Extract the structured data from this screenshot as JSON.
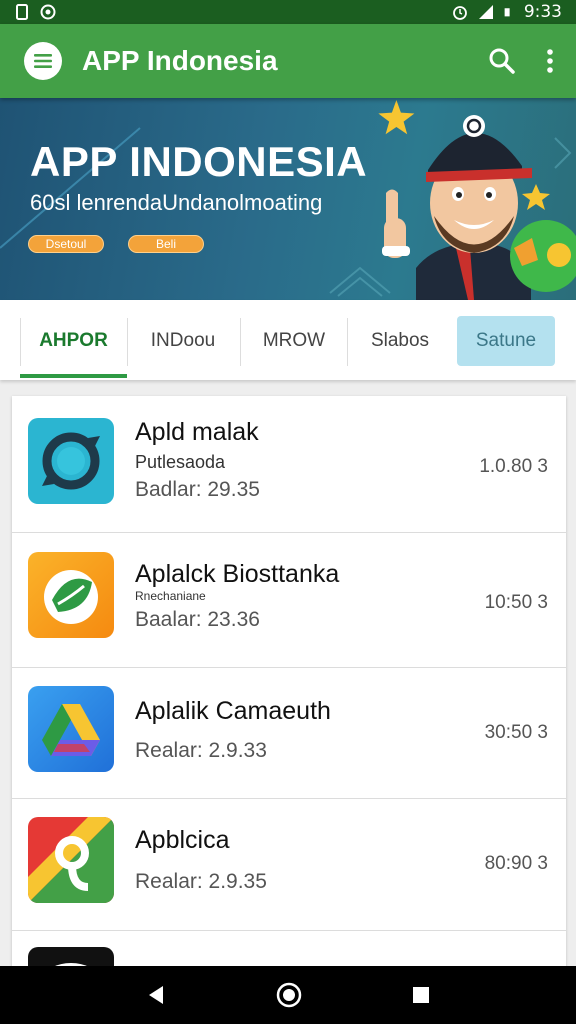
{
  "status_bar": {
    "time": "9:33"
  },
  "app_bar": {
    "title": "APP Indonesia"
  },
  "banner": {
    "title": "APP INDONESIA",
    "subtitle": "60sl lenrendaUndanolmoating",
    "button_1": "Dsetoul",
    "button_2": "Beli"
  },
  "tabs": [
    {
      "label": "AHPOR"
    },
    {
      "label": "INDoou"
    },
    {
      "label": "MROW"
    },
    {
      "label": "Slabos"
    },
    {
      "label": "Satune"
    }
  ],
  "apps": [
    {
      "name": "Apld malak",
      "subtitle": "Putlesaoda",
      "rating": "Badlar: 29.35",
      "size": "1.0.80 3",
      "icon": "sync-icon",
      "color": "#2bb5d1"
    },
    {
      "name": "Aplalck Biosttanka",
      "subtitle": "Rnechaniane",
      "rating": "Baalar: 23.36",
      "size": "10:50 3",
      "icon": "leaf-icon",
      "color": "#f59a1c"
    },
    {
      "name": "Aplalik Camaeuth",
      "subtitle": "",
      "rating": "Realar: 2.9.33",
      "size": "30:50 3",
      "icon": "drive-icon",
      "color": "#2a8ee8"
    },
    {
      "name": "Apblcica",
      "subtitle": "",
      "rating": "Realar: 2.9.35",
      "size": "80:90 3",
      "icon": "maps-icon",
      "color": "#e53935"
    }
  ]
}
